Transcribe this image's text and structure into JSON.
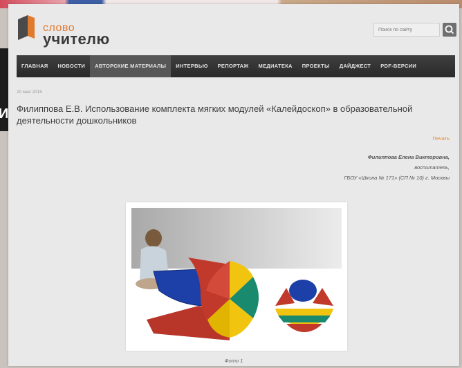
{
  "background": {
    "side_text": "И"
  },
  "header": {
    "logo_top": "слово",
    "logo_bottom": "учителю",
    "search_placeholder": "Поиск по сайту"
  },
  "nav": [
    {
      "label": "ГЛАВНАЯ",
      "active": false
    },
    {
      "label": "НОВОСТИ",
      "active": false
    },
    {
      "label": "АВТОРСКИЕ МАТЕРИАЛЫ",
      "active": true
    },
    {
      "label": "ИНТЕРВЬЮ",
      "active": false
    },
    {
      "label": "РЕПОРТАЖ",
      "active": false
    },
    {
      "label": "МЕДИАТЕКА",
      "active": false
    },
    {
      "label": "ПРОЕКТЫ",
      "active": false
    },
    {
      "label": "ДАЙДЖЕСТ",
      "active": false
    },
    {
      "label": "PDF-ВЕРСИИ",
      "active": false
    }
  ],
  "article": {
    "date": "20 мая 2015",
    "title": "Филиппова Е.В. Использование комплекта мягких модулей «Калейдоскоп» в образовательной деятельности дошкольников",
    "print_label": "Печать",
    "author_name": "Филиппова Елена Викторовна,",
    "author_role": "воспитатель,",
    "author_org": "ГБОУ «Школа № 171» (СП № 10) г. Москвы",
    "photo_caption": "Фото 1"
  },
  "colors": {
    "accent": "#e07a2f",
    "nav_bg": "#333333",
    "page_bg": "#e9e9e9",
    "module_red": "#c0392b",
    "module_yellow": "#f1c40f",
    "module_green": "#1a8a6e",
    "module_blue": "#1c3fa8"
  }
}
